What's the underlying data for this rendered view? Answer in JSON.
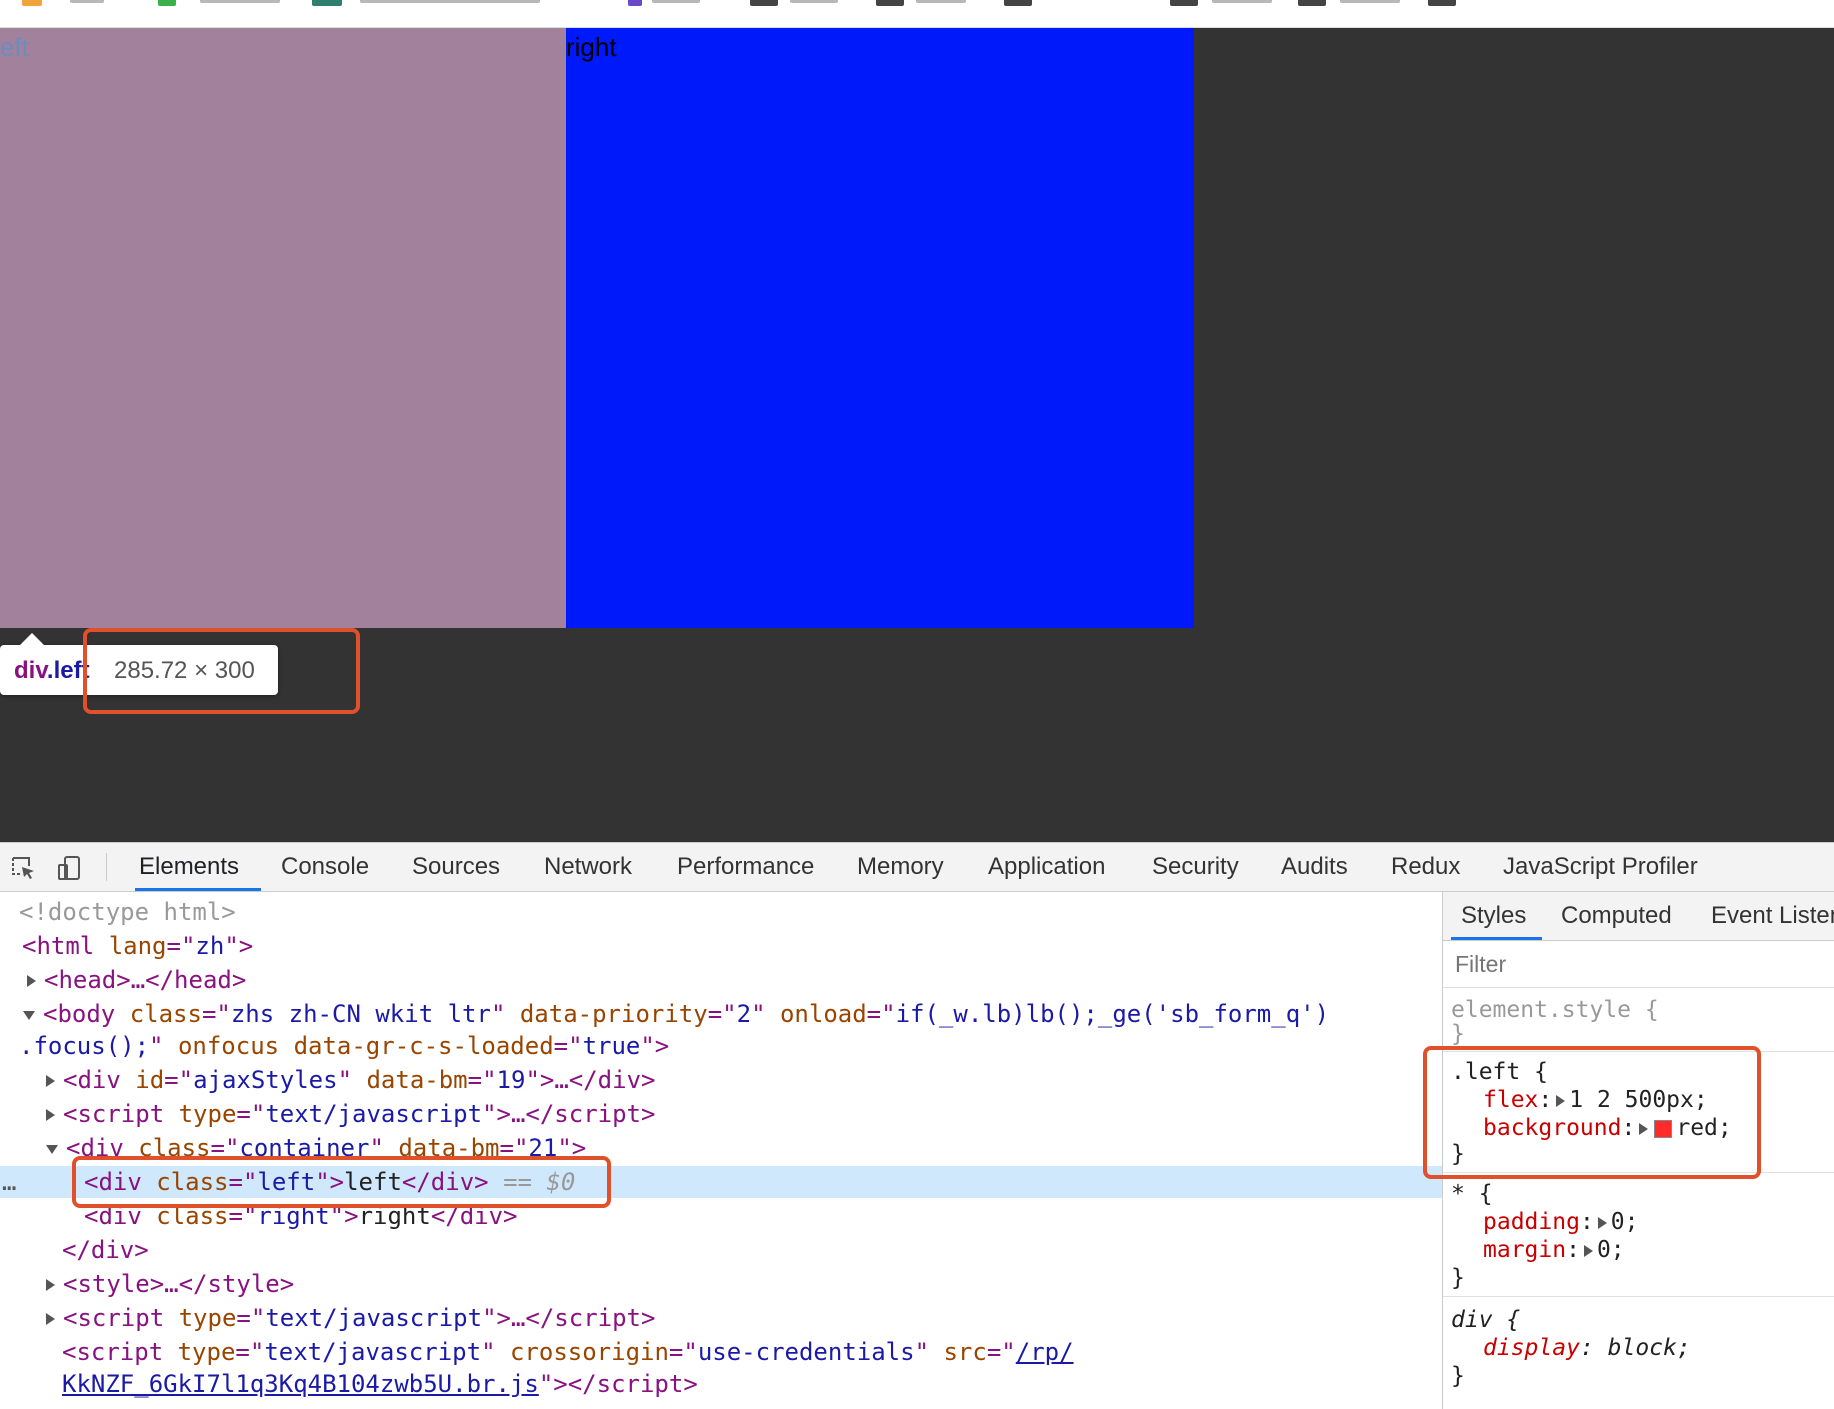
{
  "viewport": {
    "left_box_text": "eft",
    "right_box_text": "right",
    "colors": {
      "left_box": "#a2819c",
      "right_box": "#0019fb",
      "background": "#333333"
    }
  },
  "tooltip": {
    "tag_name": "div",
    "tag_class": ".left",
    "dimensions": "285.72 × 300"
  },
  "devtools": {
    "tabs": [
      "Elements",
      "Console",
      "Sources",
      "Network",
      "Performance",
      "Memory",
      "Application",
      "Security",
      "Audits",
      "Redux",
      "JavaScript Profiler"
    ],
    "active_tab": "Elements",
    "dom": {
      "doctype": "<!doctype html>",
      "html_open": {
        "tag": "html",
        "attr": "lang",
        "val": "zh"
      },
      "head": "<head>…</head>",
      "body": {
        "tag": "body",
        "class_val": "zhs zh-CN wkit ltr",
        "priority_val": "2",
        "onload_val": "if(_w.lb)lb();_ge('sb_form_q')",
        "onload_cont": ".focus();",
        "loaded_val": "true"
      },
      "ajax_styles": {
        "id_val": "ajaxStyles",
        "bm_val": "19"
      },
      "script1_type": "text/javascript",
      "container": {
        "class_val": "container",
        "bm_val": "21"
      },
      "left_div": {
        "class_val": "left",
        "text": "left",
        "marker": "== $0"
      },
      "right_div": {
        "class_val": "right",
        "text": "right"
      },
      "close_div": "</div>",
      "style": "<style>…</style>",
      "script2_type": "text/javascript",
      "script3": {
        "type_val": "text/javascript",
        "cross_val": "use-credentials",
        "src_part1": "/rp/",
        "src_part2": "KkNZF_6GkI7l1q3Kq4B104zwb5U.br.js"
      }
    },
    "styles": {
      "tabs": [
        "Styles",
        "Computed",
        "Event Listeners"
      ],
      "filter_placeholder": "Filter",
      "element_style": "element.style {",
      "left_selector": ".left {",
      "left_flex": "1 2 500px;",
      "left_background": "red;",
      "star_selector": "* {",
      "star_padding": "0;",
      "star_margin": "0;",
      "div_selector": "div {",
      "div_display": "block;",
      "swatch_color": "#ff2a2a"
    }
  }
}
